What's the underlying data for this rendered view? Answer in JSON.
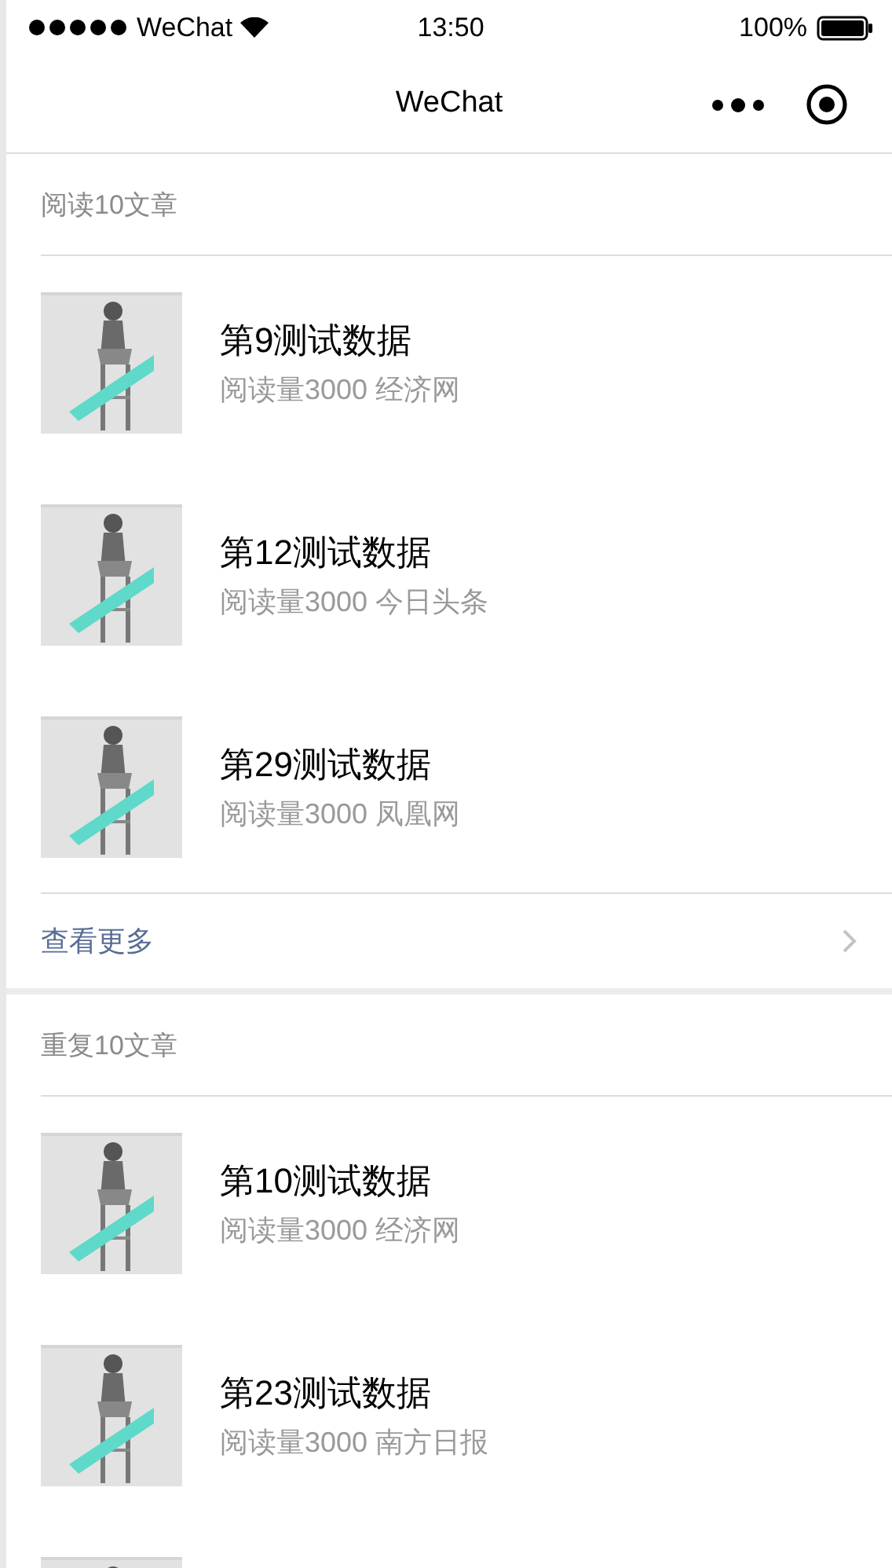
{
  "status_bar": {
    "carrier": "WeChat",
    "time": "13:50",
    "battery": "100%"
  },
  "nav_bar": {
    "title": "WeChat"
  },
  "sections": [
    {
      "header": "阅读10文章",
      "items": [
        {
          "kind": "article",
          "title": "第9测试数据",
          "subtitle": "阅读量3000 经济网"
        },
        {
          "kind": "article",
          "title": "第12测试数据",
          "subtitle": "阅读量3000 今日头条"
        },
        {
          "kind": "article",
          "title": "第29测试数据",
          "subtitle": "阅读量3000 凤凰网"
        }
      ],
      "more_link": "查看更多"
    },
    {
      "header": "重复10文章",
      "items": [
        {
          "kind": "article",
          "title": "第10测试数据",
          "subtitle": "阅读量3000 经济网"
        },
        {
          "kind": "article",
          "title": "第23测试数据",
          "subtitle": "阅读量3000 南方日报"
        },
        {
          "kind": "picture"
        }
      ]
    }
  ]
}
